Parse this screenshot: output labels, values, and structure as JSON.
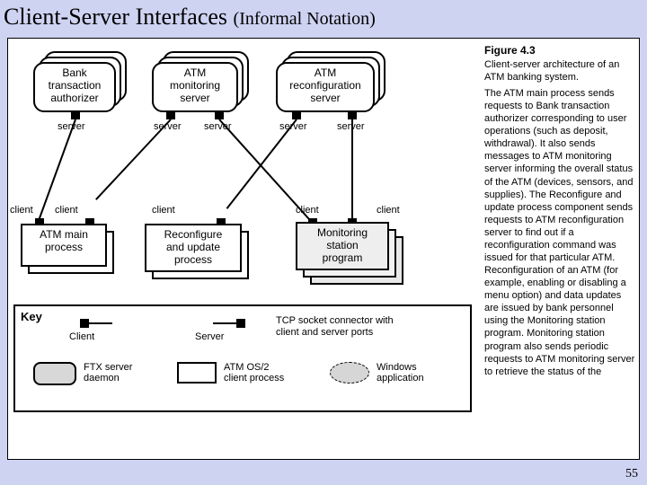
{
  "title": {
    "main": "Client-Server Interfaces",
    "sub": "(Informal Notation)"
  },
  "figure_caption": {
    "num": "Figure 4.3",
    "text": "Client-server architecture of an ATM banking system."
  },
  "servers": {
    "bank": "Bank\ntransaction\nauthorizer",
    "atm_mon": "ATM\nmonitoring\nserver",
    "atm_recfg": "ATM\nreconfiguration\nserver"
  },
  "clients": {
    "atm_main": "ATM main\nprocess",
    "recfg_upd": "Reconfigure\nand update\nprocess",
    "mon_station": "Monitoring\nstation\nprogram"
  },
  "port_labels": {
    "server": "server",
    "client": "client"
  },
  "key": {
    "title": "Key",
    "client": "Client",
    "server": "Server",
    "connector": "TCP socket connector with\nclient and server ports",
    "ftx": "FTX server\ndaemon",
    "os2": "ATM OS/2\nclient process",
    "win": "Windows\napplication"
  },
  "explanation": "The ATM main process sends requests to Bank transaction authorizer corresponding to user operations (such as deposit, withdrawal). It also sends messages to ATM monitoring server informing the overall status of the ATM (devices, sensors, and supplies). The Reconfigure and update process component sends requests to ATM reconfiguration server to find out if a reconfiguration command was issued for that particular ATM. Reconfiguration of an ATM (for example, enabling or disabling a menu option) and data updates are issued by bank personnel using the Monitoring station program. Monitoring station program also sends periodic requests to ATM monitoring server to retrieve the status of the",
  "page": "55"
}
